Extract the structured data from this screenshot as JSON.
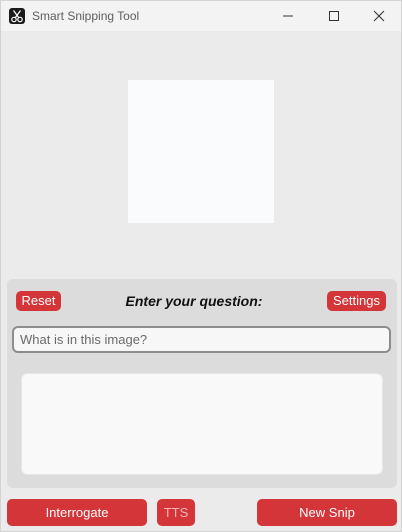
{
  "window": {
    "title": "Smart Snipping Tool",
    "app_icon": "scissors-icon",
    "controls": [
      "minimize-icon",
      "maximize-icon",
      "close-icon"
    ]
  },
  "panel": {
    "reset_label": "Reset",
    "question_label": "Enter your question:",
    "settings_label": "Settings",
    "input_value": "",
    "input_placeholder": "What is in this image?",
    "answer_text": ""
  },
  "bottom": {
    "interrogate_label": "Interrogate",
    "tts_label": "TTS",
    "new_snip_label": "New Snip"
  },
  "colors": {
    "accent": "#d33539",
    "background": "#ebebeb",
    "panel": "#dcdcdc",
    "titlebar": "#f3f3f3"
  }
}
